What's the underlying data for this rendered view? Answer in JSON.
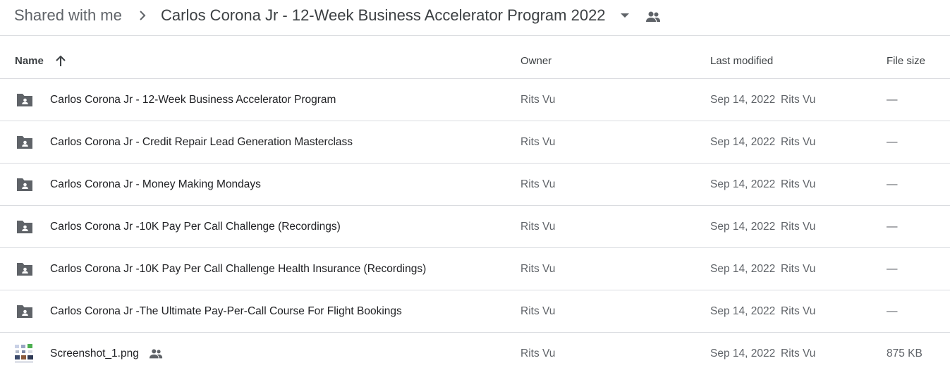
{
  "breadcrumb": {
    "root": "Shared with me",
    "current": "Carlos Corona Jr - 12-Week Business Accelerator Program 2022"
  },
  "columns": {
    "name": "Name",
    "owner": "Owner",
    "last_modified": "Last modified",
    "file_size": "File size"
  },
  "files": [
    {
      "name": "Carlos Corona Jr - 12-Week Business Accelerator Program",
      "type": "shared-folder-icon",
      "owner": "Rits Vu",
      "modified_date": "Sep 14, 2022",
      "modified_by": "Rits Vu",
      "size": "—"
    },
    {
      "name": "Carlos Corona Jr - Credit Repair Lead Generation Masterclass",
      "type": "shared-folder-icon",
      "owner": "Rits Vu",
      "modified_date": "Sep 14, 2022",
      "modified_by": "Rits Vu",
      "size": "—"
    },
    {
      "name": "Carlos Corona Jr - Money Making Mondays",
      "type": "shared-folder-icon",
      "owner": "Rits Vu",
      "modified_date": "Sep 14, 2022",
      "modified_by": "Rits Vu",
      "size": "—"
    },
    {
      "name": "Carlos Corona Jr -10K Pay Per Call Challenge (Recordings)",
      "type": "shared-folder-icon",
      "owner": "Rits Vu",
      "modified_date": "Sep 14, 2022",
      "modified_by": "Rits Vu",
      "size": "—"
    },
    {
      "name": "Carlos Corona Jr -10K Pay Per Call Challenge Health Insurance (Recordings)",
      "type": "shared-folder-icon",
      "owner": "Rits Vu",
      "modified_date": "Sep 14, 2022",
      "modified_by": "Rits Vu",
      "size": "—"
    },
    {
      "name": "Carlos Corona Jr -The Ultimate Pay-Per-Call Course For Flight Bookings",
      "type": "shared-folder-icon",
      "owner": "Rits Vu",
      "modified_date": "Sep 14, 2022",
      "modified_by": "Rits Vu",
      "size": "—"
    },
    {
      "name": "Screenshot_1.png",
      "type": "image-thumbnail",
      "shared": true,
      "owner": "Rits Vu",
      "modified_date": "Sep 14, 2022",
      "modified_by": "Rits Vu",
      "size": "875 KB"
    }
  ],
  "colors": {
    "icon": "#5f6368",
    "text": "#202124",
    "muted": "#5f6368",
    "divider": "#dadce0"
  }
}
